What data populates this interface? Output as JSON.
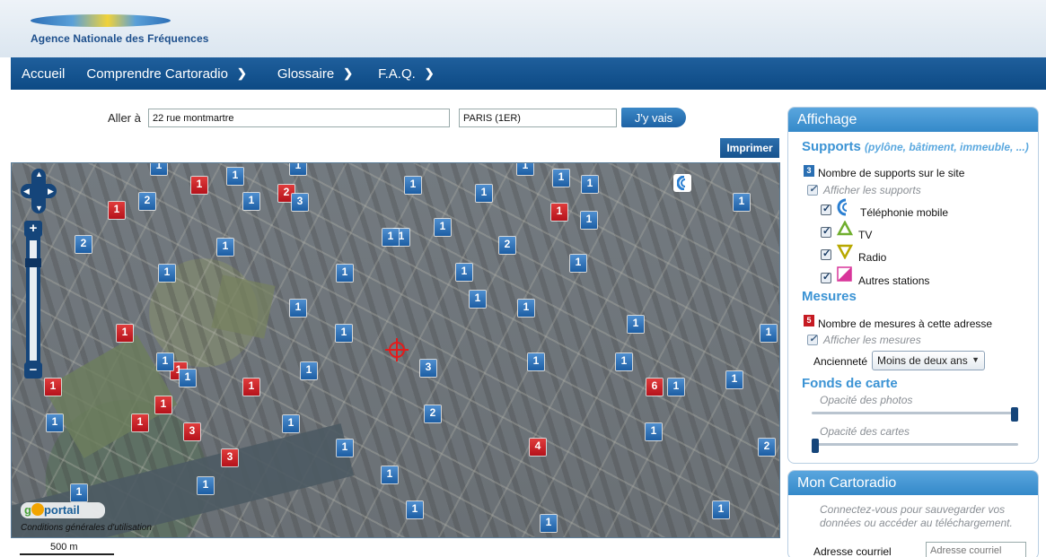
{
  "header": {
    "logo_text": "Agence Nationale des Fréquences"
  },
  "nav": {
    "items": [
      {
        "label": "Accueil",
        "chevron": false
      },
      {
        "label": "Comprendre Cartoradio",
        "chevron": true
      },
      {
        "label": "Glossaire",
        "chevron": true
      },
      {
        "label": "F.A.Q.",
        "chevron": true
      }
    ]
  },
  "search": {
    "goto_label": "Aller à",
    "address_value": "22 rue montmartre",
    "city_value": "PARIS (1ER)",
    "go_label": "J'y vais",
    "print_label": "Imprimer"
  },
  "map": {
    "markers": [
      {
        "v": "1",
        "c": "blue"
      },
      {
        "v": "1",
        "c": "blue"
      },
      {
        "v": "1",
        "c": "blue"
      },
      {
        "v": "1",
        "c": "red"
      },
      {
        "v": "2",
        "c": "blue"
      },
      {
        "v": "1",
        "c": "red"
      },
      {
        "v": "2",
        "c": "red"
      },
      {
        "v": "3",
        "c": "blue"
      },
      {
        "v": "1",
        "c": "blue"
      },
      {
        "v": "1",
        "c": "blue"
      },
      {
        "v": "1",
        "c": "blue"
      },
      {
        "v": "1",
        "c": "red"
      },
      {
        "v": "1",
        "c": "blue"
      },
      {
        "v": "1",
        "c": "blue"
      },
      {
        "v": "1",
        "c": "blue"
      },
      {
        "v": "1",
        "c": "blue"
      },
      {
        "v": "1",
        "c": "blue"
      },
      {
        "v": "1",
        "c": "blue"
      },
      {
        "v": "2",
        "c": "blue"
      },
      {
        "v": "1",
        "c": "blue"
      },
      {
        "v": "1",
        "c": "blue"
      },
      {
        "v": "1",
        "c": "blue"
      },
      {
        "v": "1",
        "c": "blue"
      },
      {
        "v": "2",
        "c": "blue"
      },
      {
        "v": "1",
        "c": "blue"
      },
      {
        "v": "1",
        "c": "blue"
      },
      {
        "v": "1",
        "c": "blue"
      },
      {
        "v": "1",
        "c": "red"
      },
      {
        "v": "1",
        "c": "blue"
      },
      {
        "v": "1",
        "c": "blue"
      },
      {
        "v": "1",
        "c": "blue"
      },
      {
        "v": "1",
        "c": "blue"
      },
      {
        "v": "1",
        "c": "red"
      },
      {
        "v": "1",
        "c": "blue"
      },
      {
        "v": "1",
        "c": "blue"
      },
      {
        "v": "1",
        "c": "blue"
      },
      {
        "v": "3",
        "c": "blue"
      },
      {
        "v": "1",
        "c": "blue"
      },
      {
        "v": "1",
        "c": "red"
      },
      {
        "v": "1",
        "c": "blue"
      },
      {
        "v": "1",
        "c": "blue"
      },
      {
        "v": "1",
        "c": "blue"
      },
      {
        "v": "6",
        "c": "red"
      },
      {
        "v": "1",
        "c": "blue"
      },
      {
        "v": "1",
        "c": "blue"
      },
      {
        "v": "1",
        "c": "red"
      },
      {
        "v": "1",
        "c": "blue"
      },
      {
        "v": "1",
        "c": "red"
      },
      {
        "v": "2",
        "c": "blue"
      },
      {
        "v": "1",
        "c": "blue"
      },
      {
        "v": "1",
        "c": "red"
      },
      {
        "v": "3",
        "c": "red"
      },
      {
        "v": "1",
        "c": "blue"
      },
      {
        "v": "1",
        "c": "blue"
      },
      {
        "v": "3",
        "c": "red"
      },
      {
        "v": "4",
        "c": "red"
      },
      {
        "v": "1",
        "c": "blue"
      },
      {
        "v": "1",
        "c": "blue"
      },
      {
        "v": "1",
        "c": "blue"
      },
      {
        "v": "1",
        "c": "blue"
      },
      {
        "v": "1",
        "c": "blue"
      },
      {
        "v": "2",
        "c": "blue"
      },
      {
        "v": "1",
        "c": "blue"
      }
    ],
    "geoportail_label": "portail",
    "cgu_label": "Conditions générales d'utilisation",
    "scale_label": "500 m"
  },
  "affichage": {
    "title": "Affichage",
    "supports_title": "Supports",
    "supports_sub": "(pylône, bâtiment, immeuble, ...)",
    "supports_count_badge": "3",
    "supports_count_label": "Nombre de supports sur le site",
    "show_supports": "Afficher les supports",
    "types": [
      "Téléphonie mobile",
      "TV",
      "Radio",
      "Autres stations"
    ],
    "mesures_title": "Mesures",
    "mesures_badge": "5",
    "mesures_count_label": "Nombre de mesures à cette adresse",
    "show_mesures": "Afficher les mesures",
    "anciennete_label": "Ancienneté",
    "anciennete_value": "Moins de deux ans",
    "fonds_title": "Fonds de carte",
    "photo_opacity_label": "Opacité des photos",
    "map_opacity_label": "Opacité des cartes",
    "photo_opacity": 1.0,
    "map_opacity": 0.0
  },
  "mon_cartoradio": {
    "title": "Mon Cartoradio",
    "text": "Connectez-vous pour sauvegarder vos données ou accéder au téléchargement.",
    "email_label": "Adresse courriel",
    "email_placeholder": "Adresse courriel"
  },
  "colors": {
    "brand": "#1f5f9c",
    "accent": "#3b93d4",
    "red_marker": "#c61a22",
    "blue_marker": "#2a6fb3"
  }
}
